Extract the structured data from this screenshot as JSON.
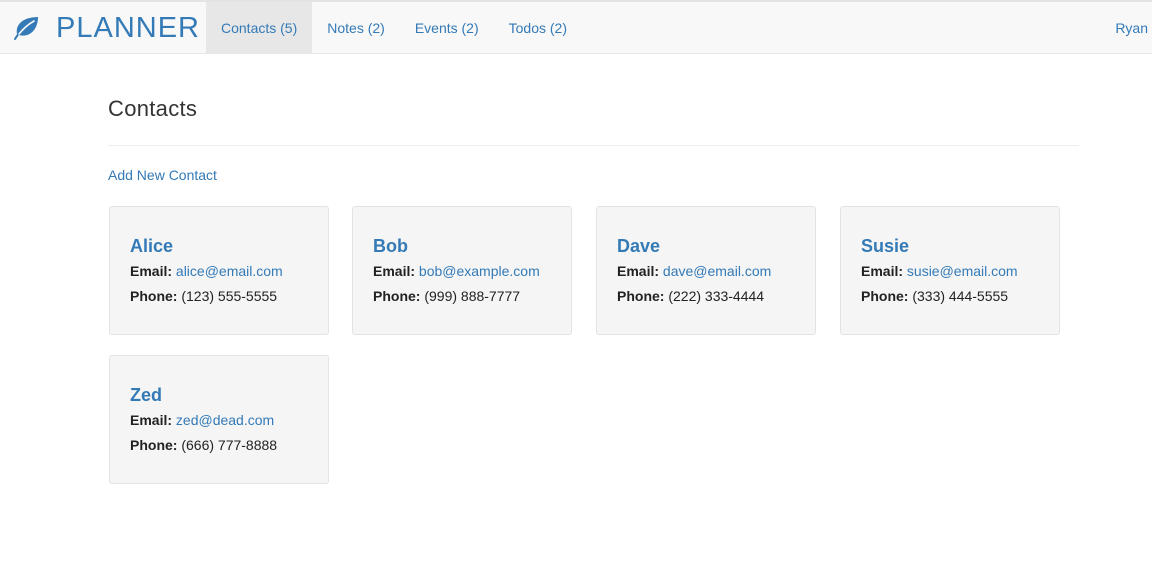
{
  "brand": {
    "text": "PLANNER",
    "icon": "leaf-icon"
  },
  "nav": {
    "tabs": [
      {
        "label": "Contacts (5)",
        "active": true
      },
      {
        "label": "Notes (2)",
        "active": false
      },
      {
        "label": "Events (2)",
        "active": false
      },
      {
        "label": "Todos (2)",
        "active": false
      }
    ],
    "user": "Ryan"
  },
  "page": {
    "title": "Contacts",
    "add_link": "Add New Contact"
  },
  "labels": {
    "email": "Email:",
    "phone": "Phone:"
  },
  "contacts": [
    {
      "name": "Alice",
      "email": "alice@email.com",
      "phone": "(123) 555-5555"
    },
    {
      "name": "Bob",
      "email": "bob@example.com",
      "phone": "(999) 888-7777"
    },
    {
      "name": "Dave",
      "email": "dave@email.com",
      "phone": "(222) 333-4444"
    },
    {
      "name": "Susie",
      "email": "susie@email.com",
      "phone": "(333) 444-5555"
    },
    {
      "name": "Zed",
      "email": "zed@dead.com",
      "phone": "(666) 777-8888"
    }
  ],
  "colors": {
    "link": "#337ab7",
    "navbar_bg": "#f8f8f8",
    "active_tab_bg": "#e7e7e7",
    "card_bg": "#f5f5f5"
  }
}
